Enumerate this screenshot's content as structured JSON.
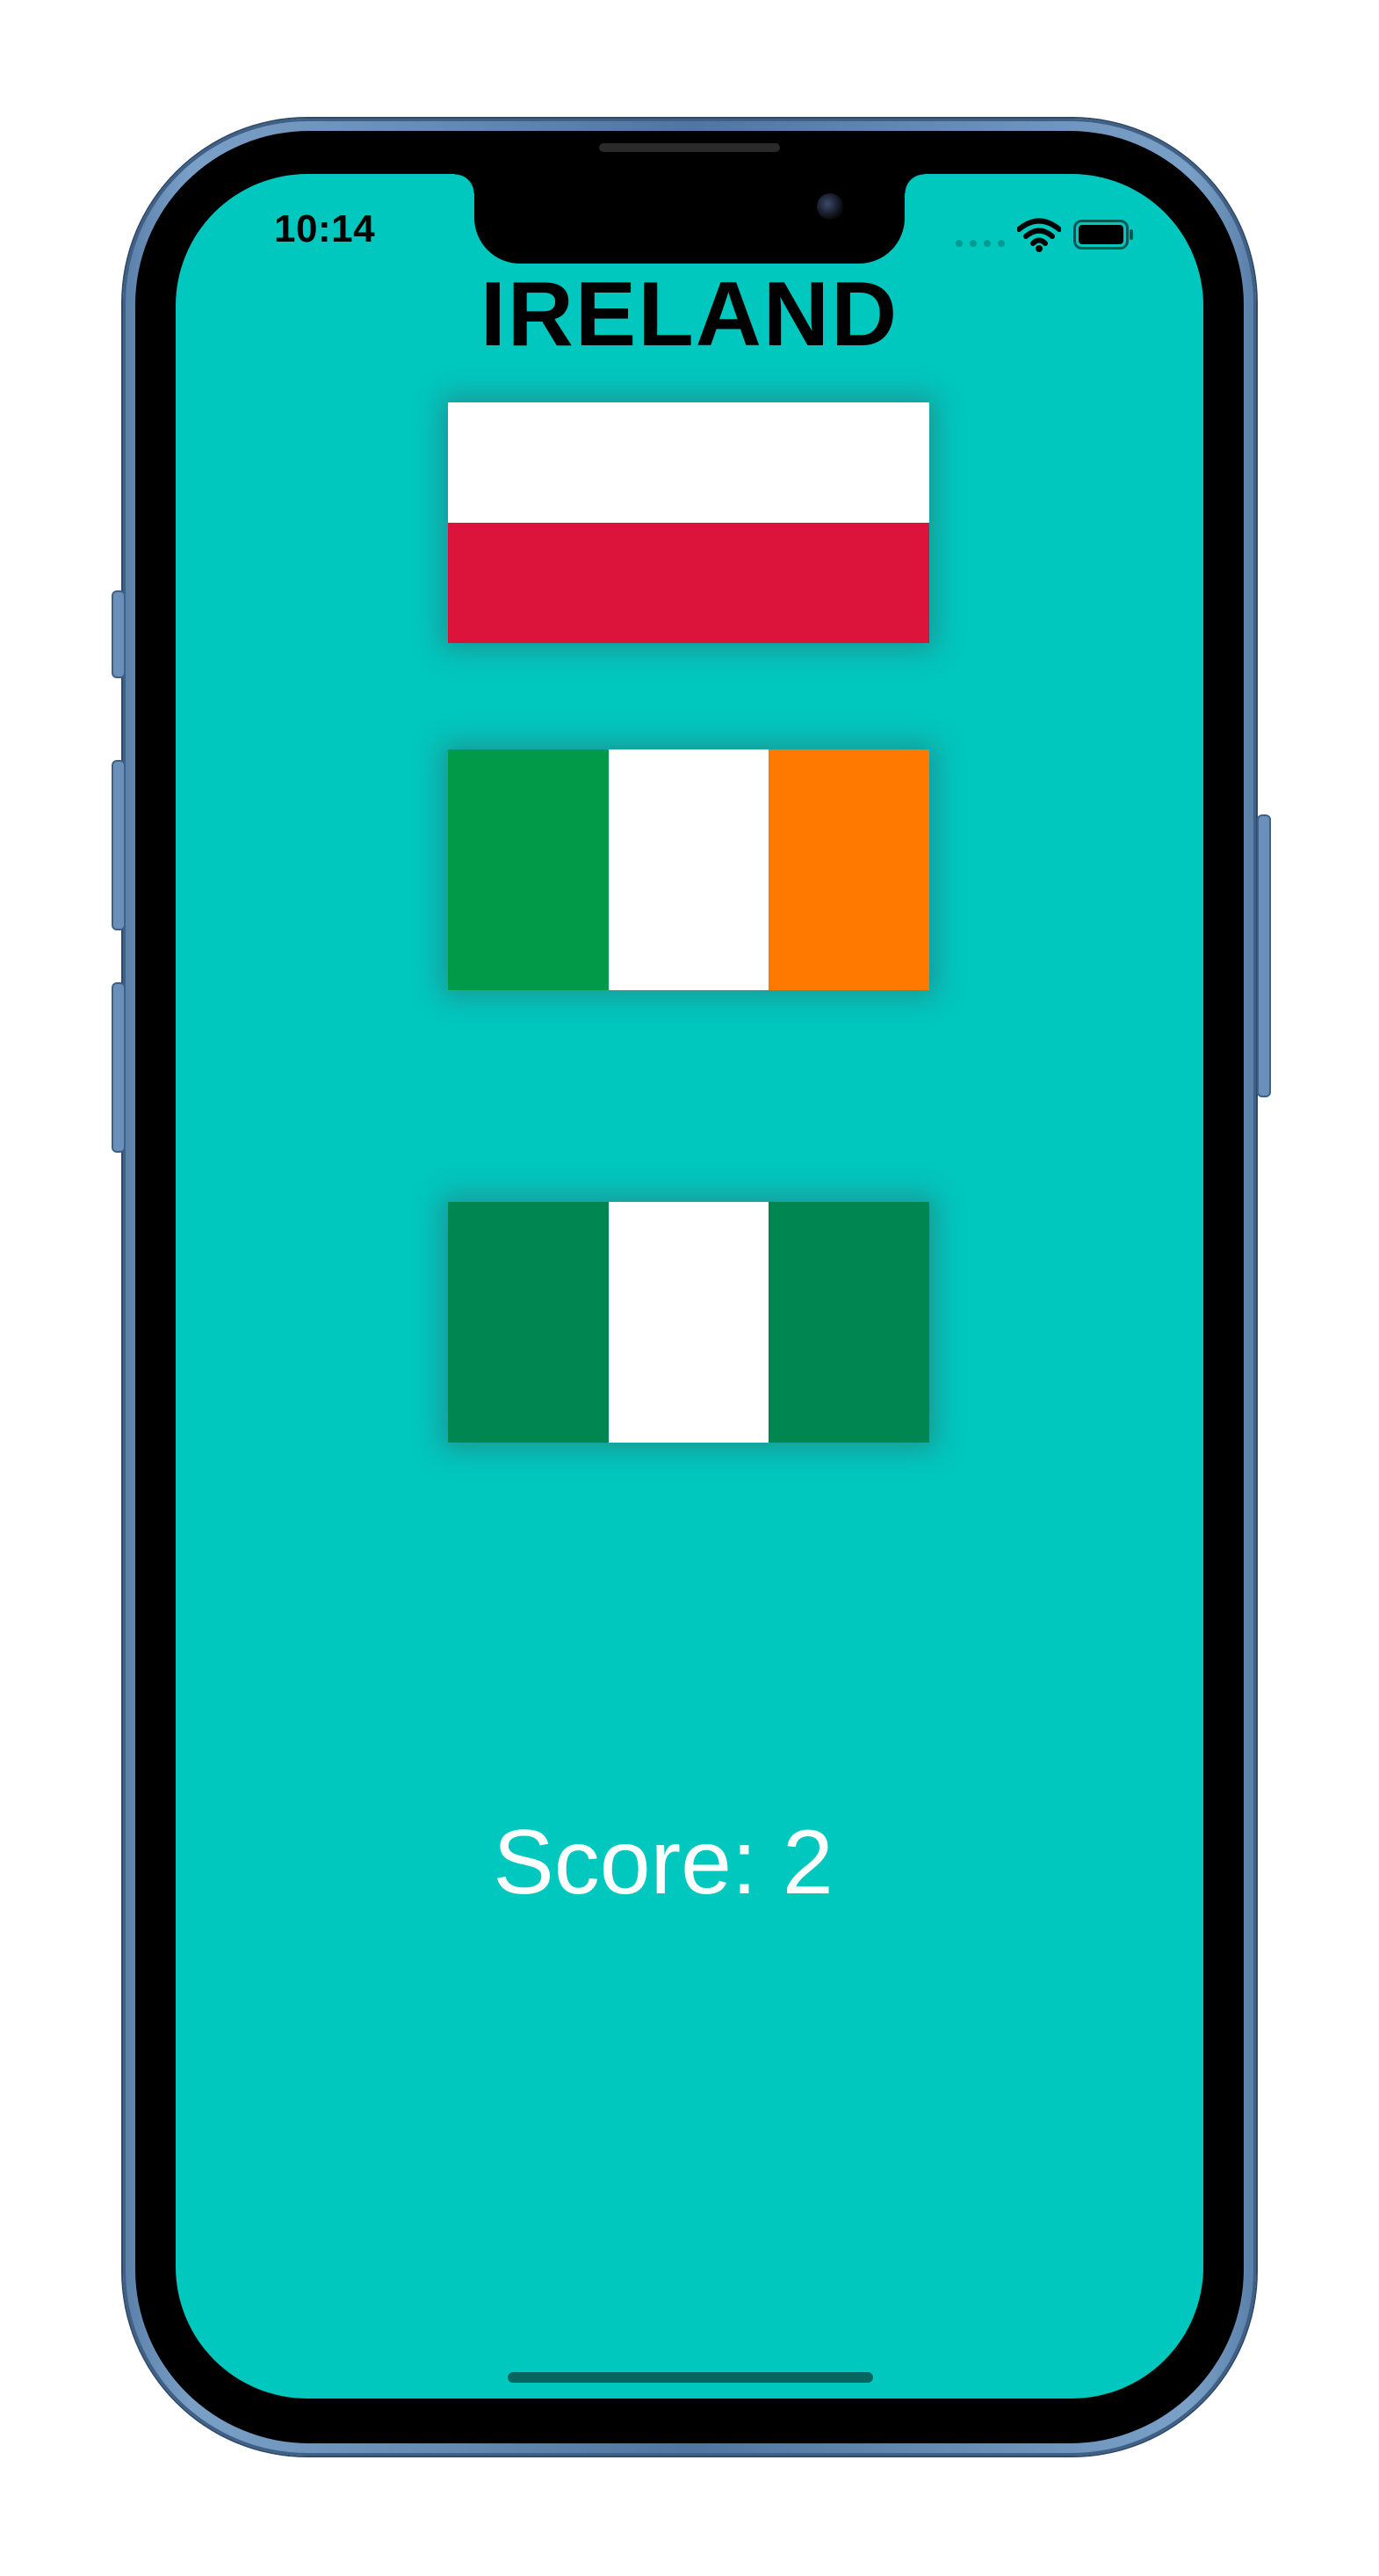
{
  "status_bar": {
    "time": "10:14",
    "wifi_icon": "wifi-icon",
    "battery_icon": "battery-icon",
    "signal_icon": "cellular-signal-icon"
  },
  "game": {
    "title": "IRELAND",
    "score_text": "Score: 2",
    "background_color": "#00c8bf",
    "flags": [
      {
        "country": "Poland",
        "layout": "horizontal",
        "stripes": [
          "#ffffff",
          "#dc143c"
        ]
      },
      {
        "country": "Ireland",
        "layout": "vertical",
        "stripes": [
          "#009a49",
          "#ffffff",
          "#ff7900"
        ]
      },
      {
        "country": "Nigeria",
        "layout": "vertical",
        "stripes": [
          "#008751",
          "#ffffff",
          "#008751"
        ]
      }
    ]
  }
}
